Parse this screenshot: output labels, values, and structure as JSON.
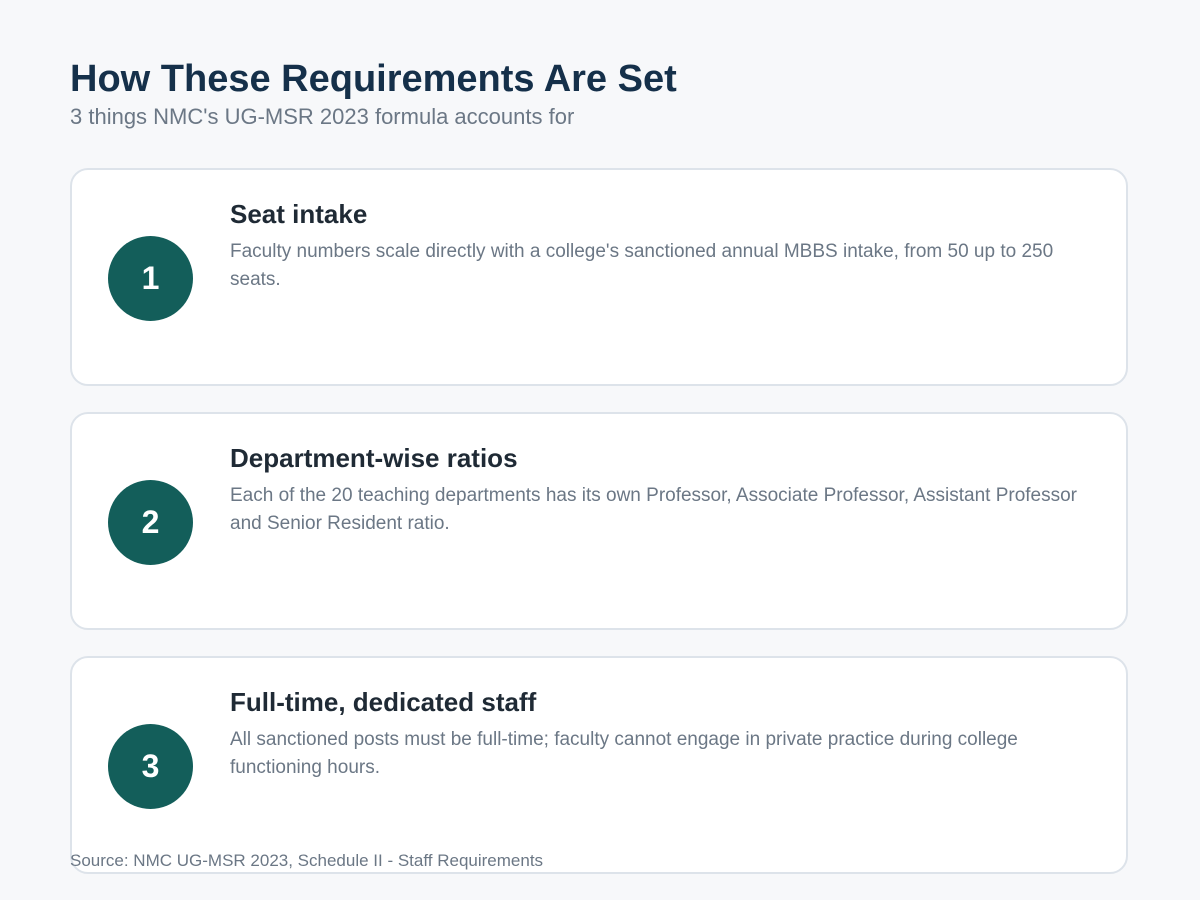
{
  "header": {
    "title": "How These Requirements Are Set",
    "subtitle": "3 things NMC's UG-MSR 2023 formula accounts for"
  },
  "cards": [
    {
      "number": "1",
      "title": "Seat intake",
      "description": "Faculty numbers scale directly with a college's sanctioned annual MBBS intake, from 50 up to 250 seats."
    },
    {
      "number": "2",
      "title": "Department-wise ratios",
      "description": "Each of the 20 teaching departments has its own Professor, Associate Professor, Assistant Professor and Senior Resident ratio."
    },
    {
      "number": "3",
      "title": "Full-time, dedicated staff",
      "description": "All sanctioned posts must be full-time; faculty cannot engage in private practice during college functioning hours."
    }
  ],
  "footer": {
    "source": "Source: NMC UG-MSR 2023, Schedule II - Staff Requirements"
  },
  "colors": {
    "background": "#f7f8fa",
    "title": "#15304a",
    "badge": "#135e5a",
    "muted_text": "#6b7785",
    "card_border": "#dde3ea"
  }
}
